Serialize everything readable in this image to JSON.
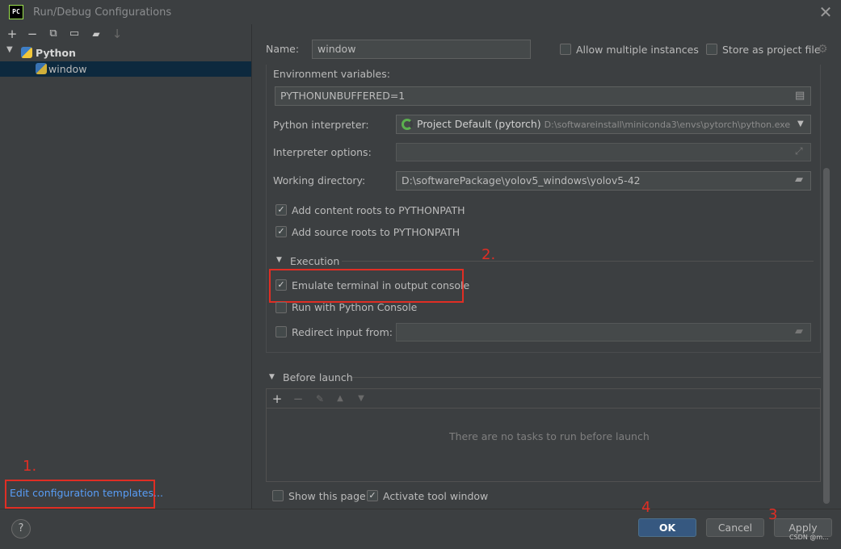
{
  "window": {
    "title": "Run/Debug Configurations",
    "logo": "PC",
    "close": "✕"
  },
  "toolbar": {
    "add": "+",
    "remove": "−",
    "copy": "⧉",
    "save": "▭",
    "folder": "▰",
    "sort": "↓"
  },
  "tree": {
    "group": "Python",
    "item": "window"
  },
  "left_footer": {
    "link": "Edit configuration templates...",
    "marker": "1."
  },
  "config": {
    "name_label": "Name:",
    "name_value": "window",
    "allow_multiple": "Allow multiple instances",
    "store_project": "Store as project file",
    "env_label": "Environment variables:",
    "env_value": "PYTHONUNBUFFERED=1",
    "interpreter_label": "Python interpreter:",
    "interpreter_name": "Project Default (pytorch)",
    "interpreter_path": "D:\\softwareinstall\\miniconda3\\envs\\pytorch\\python.exe",
    "interp_options_label": "Interpreter options:",
    "workdir_label": "Working directory:",
    "workdir_value": "D:\\softwarePackage\\yolov5_windows\\yolov5-42",
    "add_content_roots": "Add content roots to PYTHONPATH",
    "add_source_roots": "Add source roots to PYTHONPATH",
    "execution_title": "Execution",
    "execution_marker": "2.",
    "emulate_terminal": "Emulate terminal in output console",
    "run_python_console": "Run with Python Console",
    "redirect_input": "Redirect input from:"
  },
  "before_launch": {
    "title": "Before launch",
    "empty_text": "There are no tasks to run before launch",
    "add": "+",
    "remove": "−",
    "edit": "✎",
    "up": "▲",
    "down": "▼"
  },
  "footer_options": {
    "show_page": "Show this page",
    "activate_tool": "Activate tool window"
  },
  "buttons": {
    "ok": "OK",
    "cancel": "Cancel",
    "apply": "Apply",
    "help": "?",
    "ok_marker": "4",
    "apply_marker": "3"
  },
  "watermark": "CSDN @m..."
}
